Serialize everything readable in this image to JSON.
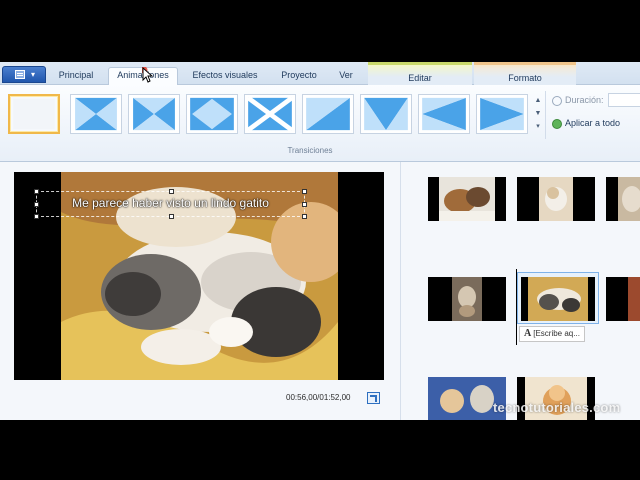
{
  "ribbon": {
    "tabs": [
      "Principal",
      "Animaciones",
      "Efectos visuales",
      "Proyecto",
      "Ver"
    ],
    "active_tab": "Animaciones",
    "contextual_tabs": [
      "Editar",
      "Formato"
    ],
    "group_label": "Transiciones",
    "duration_label": "Duración:",
    "apply_all_label": "Aplicar a todo",
    "scroll_up": "▲",
    "scroll_down": "▼",
    "scroll_more": "▾",
    "app_menu_dropdown": "▾"
  },
  "transitions": [
    "none",
    "hourglass-vertical",
    "hourglass-horizontal",
    "diamond",
    "x-cross",
    "diagonal-wipe",
    "chevron-down",
    "arrow-left",
    "arrow-right"
  ],
  "preview": {
    "caption": "Me parece haber visto un lindo gatito",
    "timecode": "00:56,00/01:52,00"
  },
  "storyboard": {
    "caption_chip": "[Escribe aq...",
    "caption_chip_icon": "A"
  },
  "watermark": "tecnotutoriales.com",
  "colors": {
    "accent_blue": "#2d6fc0",
    "selection_gold": "#f0b84a",
    "ctx_edit": "#c9d86a",
    "ctx_format": "#f0c48a"
  }
}
